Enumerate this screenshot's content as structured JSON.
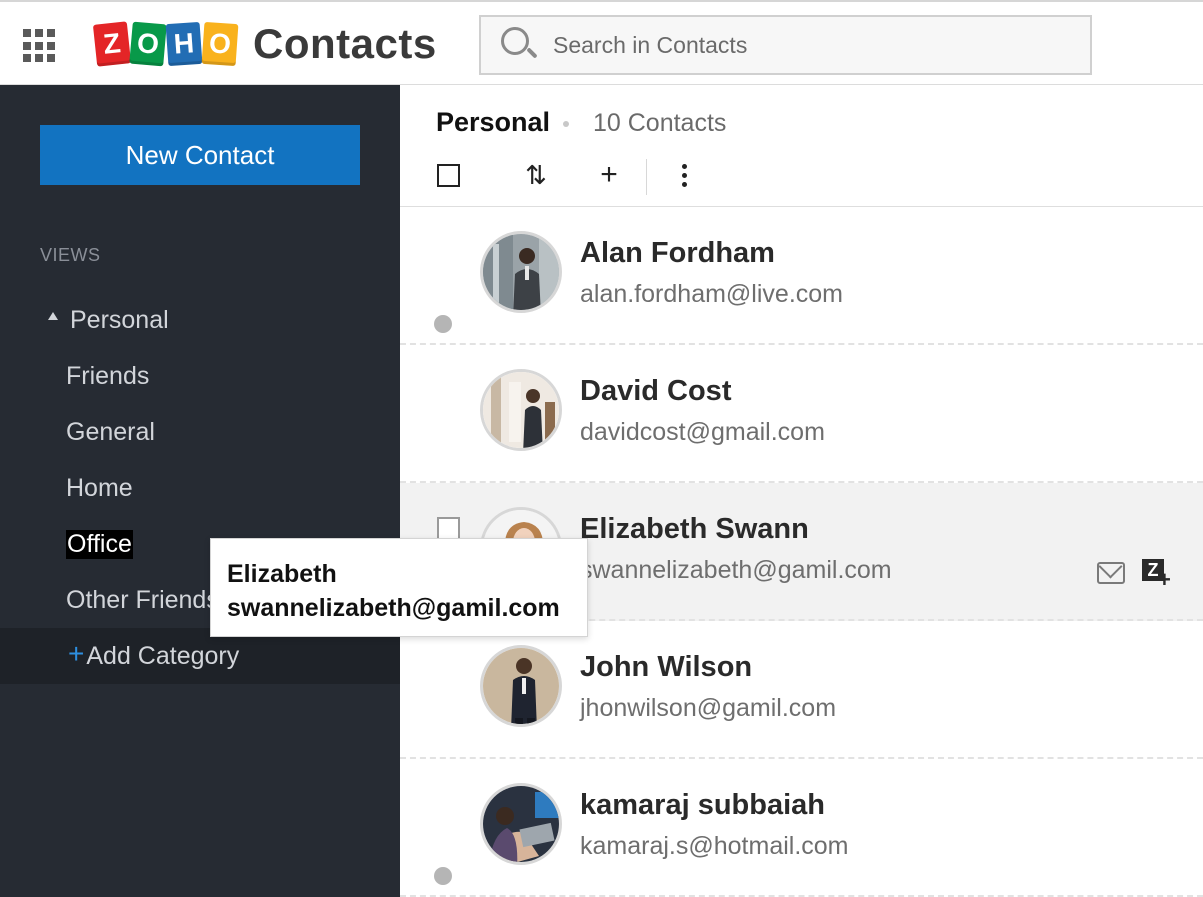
{
  "header": {
    "brand_letters": [
      "Z",
      "O",
      "H",
      "O"
    ],
    "app_title": "Contacts",
    "search_placeholder": "Search in Contacts"
  },
  "sidebar": {
    "new_contact_label": "New Contact",
    "views_heading": "VIEWS",
    "personal_label": "Personal",
    "items": [
      {
        "label": "Friends"
      },
      {
        "label": "General"
      },
      {
        "label": "Home"
      },
      {
        "label": "Office"
      },
      {
        "label": "Other Friends"
      }
    ],
    "add_category_label": "Add Category"
  },
  "main": {
    "title": "Personal",
    "count": "10 Contacts",
    "contacts": [
      {
        "name": "Alan Fordham",
        "email": "alan.fordham@live.com"
      },
      {
        "name": "David Cost",
        "email": "davidcost@gmail.com"
      },
      {
        "name": "Elizabeth Swann",
        "email": "swannelizabeth@gamil.com"
      },
      {
        "name": "John Wilson",
        "email": "jhonwilson@gamil.com"
      },
      {
        "name": "kamaraj subbaiah",
        "email": "kamaraj.s@hotmail.com"
      }
    ]
  },
  "tooltip": {
    "name": "Elizabeth",
    "email": "swannelizabeth@gamil.com"
  },
  "icons": {
    "apps": "grid-icon",
    "search": "search-icon",
    "select_all": "checkbox-icon",
    "sort": "sort-icon",
    "add": "plus-icon",
    "more": "kebab-icon",
    "mail": "mail-icon",
    "zplus": "zoho-add-icon"
  },
  "colors": {
    "accent": "#1273c1",
    "sidebar_bg": "#262b33",
    "logo_z": "#e42527",
    "logo_o1": "#089949",
    "logo_h": "#226db4",
    "logo_o2": "#f9b21d"
  }
}
